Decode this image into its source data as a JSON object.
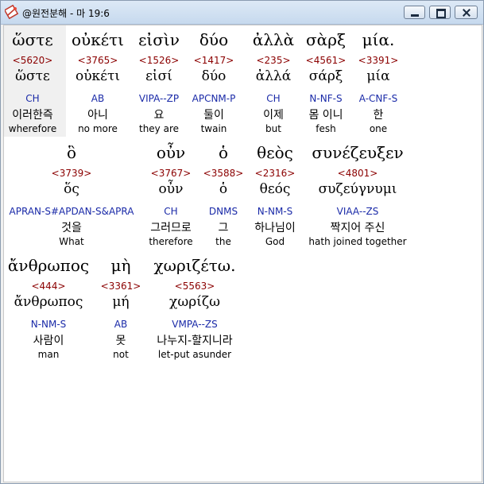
{
  "window": {
    "title": "@원전분해 - 마 19:6",
    "icon": "app-logo-icon"
  },
  "title_buttons": {
    "minimize": "minimize-icon",
    "maximize": "maximize-icon",
    "close": "close-icon"
  },
  "lines": [
    [
      {
        "greek": "ὥστε",
        "strong": "<5620>",
        "lemma": "ὥστε",
        "parse": "CH",
        "korean": "이러한즉",
        "english": "wherefore"
      },
      {
        "greek": "οὐκέτι",
        "strong": "<3765>",
        "lemma": "οὐκέτι",
        "parse": "AB",
        "korean": "아니",
        "english": "no more"
      },
      {
        "greek": "εἰσὶν",
        "strong": "<1526>",
        "lemma": "εἰσί",
        "parse": "VIPA--ZP",
        "korean": "요",
        "english": "they are"
      },
      {
        "greek": "δύο",
        "strong": "<1417>",
        "lemma": "δύο",
        "parse": "APCNM-P",
        "korean": "둘이",
        "english": "twain"
      },
      {
        "greek": "ἀλλὰ",
        "strong": "<235>",
        "lemma": "ἀλλά",
        "parse": "CH",
        "korean": "이제",
        "english": "but"
      },
      {
        "greek": "σὰρξ",
        "strong": "<4561>",
        "lemma": "σάρξ",
        "parse": "N-NF-S",
        "korean": "몸 이니",
        "english": "fesh"
      },
      {
        "greek": "μία.",
        "strong": "<3391>",
        "lemma": "μία",
        "parse": "A-CNF-S",
        "korean": "한",
        "english": "one"
      }
    ],
    [
      {
        "greek": "ὃ",
        "strong": "<3739>",
        "lemma": "ὅς",
        "parse": "APRAN-S#APDAN-S&APRA",
        "korean": "것을",
        "english": "What"
      },
      {
        "greek": "οὖν",
        "strong": "<3767>",
        "lemma": "οὖν",
        "parse": "CH",
        "korean": "그러므로",
        "english": "therefore"
      },
      {
        "greek": "ὁ",
        "strong": "<3588>",
        "lemma": "ὁ",
        "parse": "DNMS",
        "korean": "그",
        "english": "the"
      },
      {
        "greek": "θεὸς",
        "strong": "<2316>",
        "lemma": "θεός",
        "parse": "N-NM-S",
        "korean": "하나님이",
        "english": "God"
      },
      {
        "greek": "συνέζευξεν",
        "strong": "<4801>",
        "lemma": "συζεύγνυμι",
        "parse": "VIAA--ZS",
        "korean": "짝지어 주신",
        "english": "hath joined together"
      }
    ],
    [
      {
        "greek": "ἄνθρωπος",
        "strong": "<444>",
        "lemma": "ἄνθρωπος",
        "parse": "N-NM-S",
        "korean": "사람이",
        "english": "man"
      },
      {
        "greek": "μὴ",
        "strong": "<3361>",
        "lemma": "μή",
        "parse": "AB",
        "korean": "못",
        "english": "not"
      },
      {
        "greek": "χωριζέτω.",
        "strong": "<5563>",
        "lemma": "χωρίζω",
        "parse": "VMPA--ZS",
        "korean": "나누지-할지니라",
        "english": "let-put asunder"
      }
    ]
  ]
}
